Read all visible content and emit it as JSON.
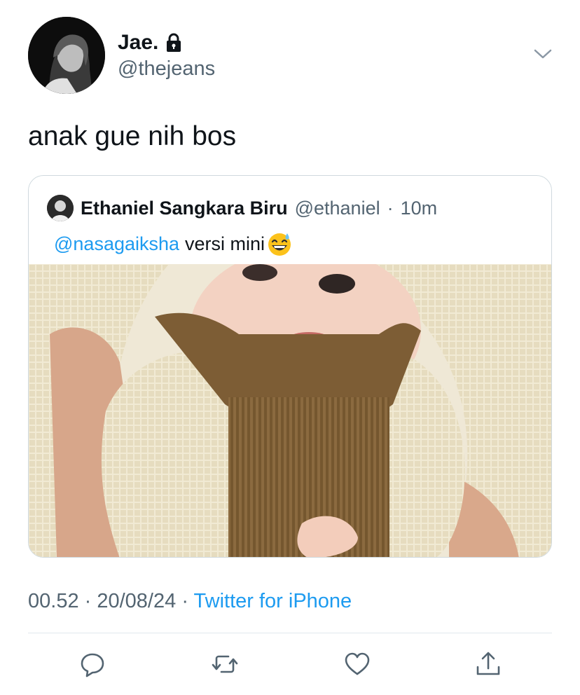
{
  "tweet": {
    "display_name": "Jae.",
    "handle": "@thejeans",
    "text": "anak gue nih bos",
    "time": "00.52",
    "date": "20/08/24",
    "source": "Twitter for iPhone"
  },
  "quote": {
    "display_name": "Ethaniel Sangkara Biru",
    "handle": "@ethaniel",
    "age": "10m",
    "mention": "@nasagaiksha",
    "text": "versi mini"
  },
  "icons": {
    "lock": "lock-icon",
    "chevron": "chevron-down-icon",
    "reply": "reply-icon",
    "retweet": "retweet-icon",
    "like": "heart-icon",
    "share": "share-icon",
    "emoji": "sweat-smile-emoji"
  },
  "colors": {
    "link": "#1d9bf0",
    "secondary_text": "#536471",
    "border": "#cfd9de"
  }
}
